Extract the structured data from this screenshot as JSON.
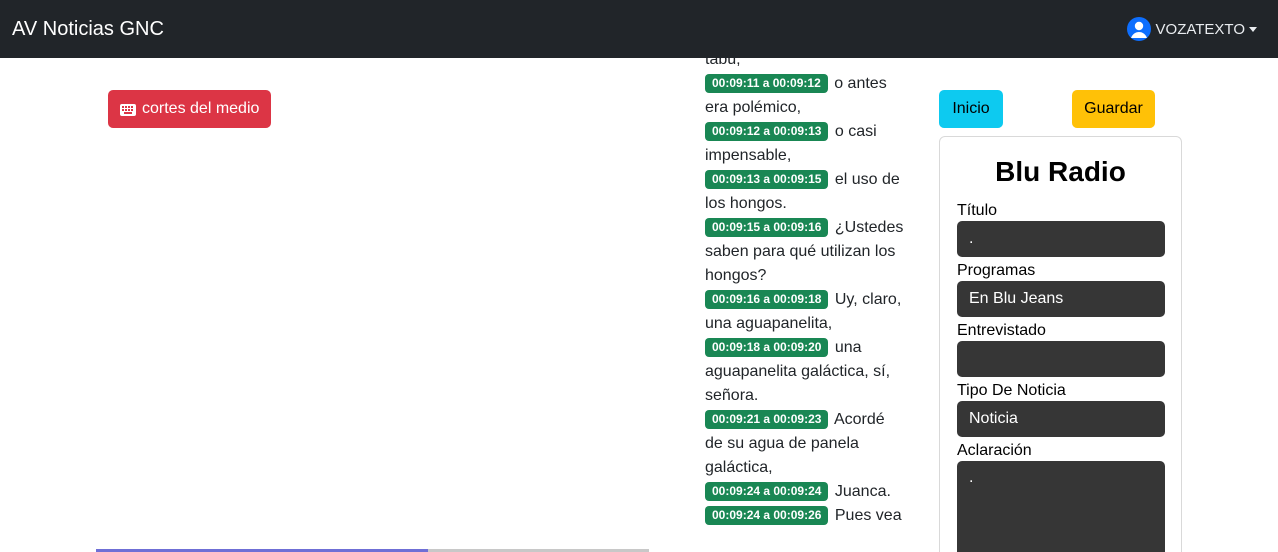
{
  "navbar": {
    "brand": "AV Noticias GNC",
    "user": "VOZATEXTO"
  },
  "cortes_button": "cortes del medio",
  "player": {
    "progress_percent": 60
  },
  "transcript": {
    "top_fragment": "tabú,",
    "segments": [
      {
        "time": "00:09:11 a 00:09:12",
        "text": "o antes era polémico,"
      },
      {
        "time": "00:09:12 a 00:09:13",
        "text": "o casi impensable,"
      },
      {
        "time": "00:09:13 a 00:09:15",
        "text": "el uso de los hongos."
      },
      {
        "time": "00:09:15 a 00:09:16",
        "text": "¿Ustedes saben para qué utilizan los hongos?"
      },
      {
        "time": "00:09:16 a 00:09:18",
        "text": "Uy, claro, una aguapanelita,"
      },
      {
        "time": "00:09:18 a 00:09:20",
        "text": "una aguapanelita galáctica, sí, señora."
      },
      {
        "time": "00:09:21 a 00:09:23",
        "text": "Acordé de su agua de panela galáctica,"
      },
      {
        "time": "00:09:24 a 00:09:24",
        "text": "Juanca."
      },
      {
        "time": "00:09:24 a 00:09:26",
        "text": "Pues vea"
      }
    ]
  },
  "buttons": {
    "inicio": "Inicio",
    "guardar": "Guardar"
  },
  "form": {
    "title": "Blu Radio",
    "titulo_label": "Título",
    "titulo_value": ".",
    "programas_label": "Programas",
    "programas_value": "En Blu Jeans",
    "entrevistado_label": "Entrevistado",
    "entrevistado_value": "",
    "tipo_label": "Tipo De Noticia",
    "tipo_value": "Noticia",
    "aclaracion_label": "Aclaración",
    "aclaracion_value": "."
  }
}
